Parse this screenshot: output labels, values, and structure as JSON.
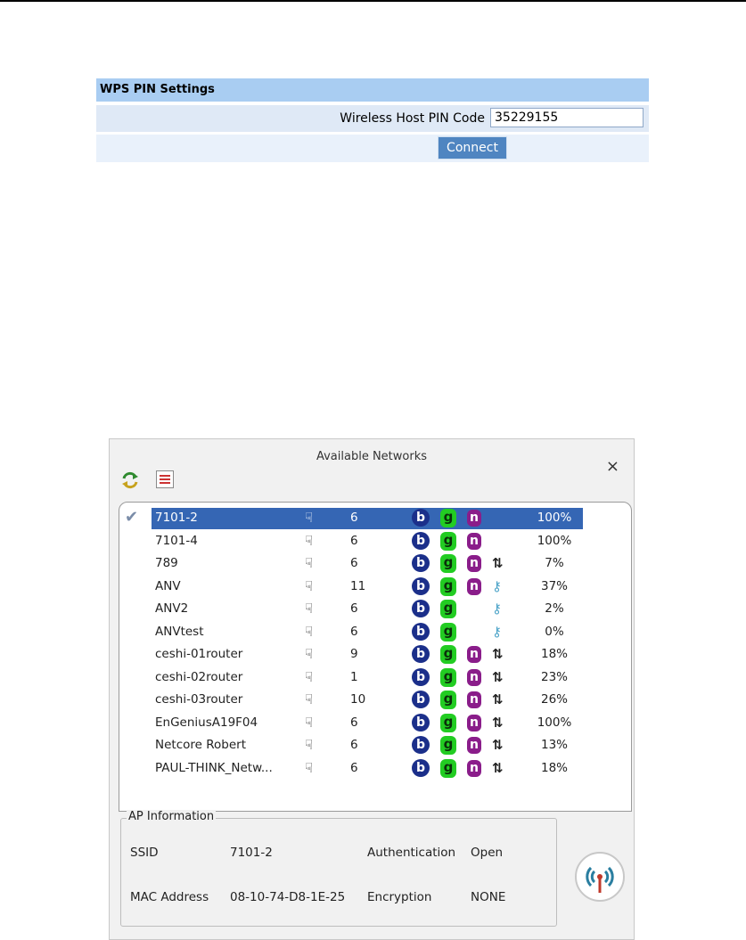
{
  "wps": {
    "title": "WPS PIN Settings",
    "pin_label": "Wireless Host PIN Code",
    "pin_value": "35229155",
    "connect_label": "Connect"
  },
  "networks_window": {
    "title": "Available Networks",
    "close_glyph": "×",
    "toolbar_icons": [
      "refresh-icon",
      "list-view-icon"
    ],
    "networks": [
      {
        "ssid": "7101-2",
        "channel": "6",
        "b": true,
        "g": true,
        "n": true,
        "security": "none",
        "signal": "100%",
        "connected": true
      },
      {
        "ssid": "7101-4",
        "channel": "6",
        "b": true,
        "g": true,
        "n": true,
        "security": "none",
        "signal": "100%"
      },
      {
        "ssid": "789",
        "channel": "6",
        "b": true,
        "g": true,
        "n": true,
        "security": "wps",
        "signal": "7%"
      },
      {
        "ssid": "ANV",
        "channel": "11",
        "b": true,
        "g": true,
        "n": true,
        "security": "key",
        "signal": "37%"
      },
      {
        "ssid": "ANV2",
        "channel": "6",
        "b": true,
        "g": true,
        "n": false,
        "security": "key",
        "signal": "2%"
      },
      {
        "ssid": "ANVtest",
        "channel": "6",
        "b": true,
        "g": true,
        "n": false,
        "security": "key",
        "signal": "0%"
      },
      {
        "ssid": "ceshi-01router",
        "channel": "9",
        "b": true,
        "g": true,
        "n": true,
        "security": "wps",
        "signal": "18%"
      },
      {
        "ssid": "ceshi-02router",
        "channel": "1",
        "b": true,
        "g": true,
        "n": true,
        "security": "wps",
        "signal": "23%"
      },
      {
        "ssid": "ceshi-03router",
        "channel": "10",
        "b": true,
        "g": true,
        "n": true,
        "security": "wps",
        "signal": "26%"
      },
      {
        "ssid": "EnGeniusA19F04",
        "channel": "6",
        "b": true,
        "g": true,
        "n": true,
        "security": "wps",
        "signal": "100%"
      },
      {
        "ssid": "Netcore Robert",
        "channel": "6",
        "b": true,
        "g": true,
        "n": true,
        "security": "wps",
        "signal": "13%"
      },
      {
        "ssid": "PAUL-THINK_Netw...",
        "channel": "6",
        "b": true,
        "g": true,
        "n": true,
        "security": "wps",
        "signal": "18%"
      }
    ],
    "ap_info": {
      "legend": "AP Information",
      "ssid_label": "SSID",
      "ssid_value": "7101-2",
      "mac_label": "MAC Address",
      "mac_value": "08-10-74-D8-1E-25",
      "auth_label": "Authentication",
      "auth_value": "Open",
      "enc_label": "Encryption",
      "enc_value": "NONE"
    }
  }
}
